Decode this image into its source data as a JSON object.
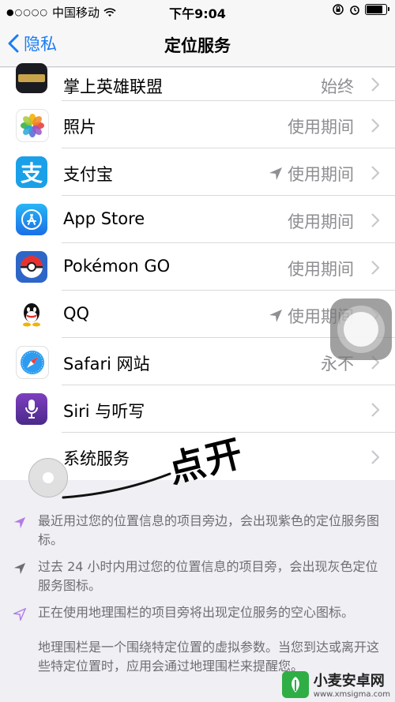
{
  "status_bar": {
    "signal": "●○○○○",
    "carrier": "中国移动",
    "time": "下午9:04"
  },
  "nav": {
    "back_label": "隐私",
    "title": "定位服务"
  },
  "apps": [
    {
      "name": "掌上英雄联盟",
      "value": "始终",
      "icon": "lol-icon",
      "arrow": false
    },
    {
      "name": "照片",
      "value": "使用期间",
      "icon": "photos-icon",
      "arrow": false
    },
    {
      "name": "支付宝",
      "value": "使用期间",
      "icon": "alipay-icon",
      "arrow": true
    },
    {
      "name": "App Store",
      "value": "使用期间",
      "icon": "appstore-icon",
      "arrow": false
    },
    {
      "name": "Pokémon GO",
      "value": "使用期间",
      "icon": "pokemongo-icon",
      "arrow": false
    },
    {
      "name": "QQ",
      "value": "使用期间",
      "icon": "qq-icon",
      "arrow": true
    },
    {
      "name": "Safari 网站",
      "value": "永不",
      "icon": "safari-icon",
      "arrow": false
    },
    {
      "name": "Siri 与听写",
      "value": "",
      "icon": "siri-icon",
      "arrow": false
    },
    {
      "name": "系统服务",
      "value": "",
      "icon": "",
      "arrow": false
    }
  ],
  "notes": [
    "最近用过您的位置信息的项目旁边，会出现紫色的定位服务图标。",
    "过去 24 小时内用过您的位置信息的项目旁，会出现灰色定位服务图标。",
    "正在使用地理围栏的项目旁将出现定位服务的空心图标。",
    "地理围栏是一个围绕特定位置的虚拟参数。当您到达或离开这些特定位置时，应用会通过地理围栏来提醒您。"
  ],
  "annotation": "点开",
  "watermark": {
    "name": "小麦安卓网",
    "url": "www.xmsigma.com"
  },
  "colors": {
    "accent": "#1a7cf5",
    "purple_arrow": "#b27be6",
    "gray_arrow": "#8e8e93"
  }
}
